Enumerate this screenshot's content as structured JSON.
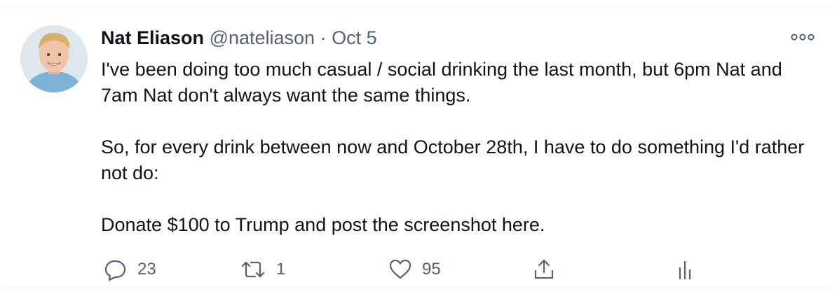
{
  "tweet": {
    "author_name": "Nat Eliason",
    "handle": "@nateliason",
    "separator": "·",
    "date": "Oct 5",
    "paragraphs": [
      "I've been doing too much casual / social drinking the last month, but 6pm Nat and 7am Nat don't always want the same things.",
      "So, for every drink between now and October 28th, I have to do something I'd rather not do:",
      "Donate $100 to Trump and post the screenshot here."
    ],
    "icons": {
      "more": "more-options-icon",
      "reply": "reply-icon",
      "retweet": "retweet-icon",
      "like": "like-icon",
      "share": "share-icon",
      "analytics": "analytics-icon"
    },
    "counts": {
      "replies": "23",
      "retweets": "1",
      "likes": "95"
    }
  },
  "colors": {
    "text_primary": "#0f1419",
    "text_secondary": "#536471",
    "divider": "#eff3f4"
  }
}
